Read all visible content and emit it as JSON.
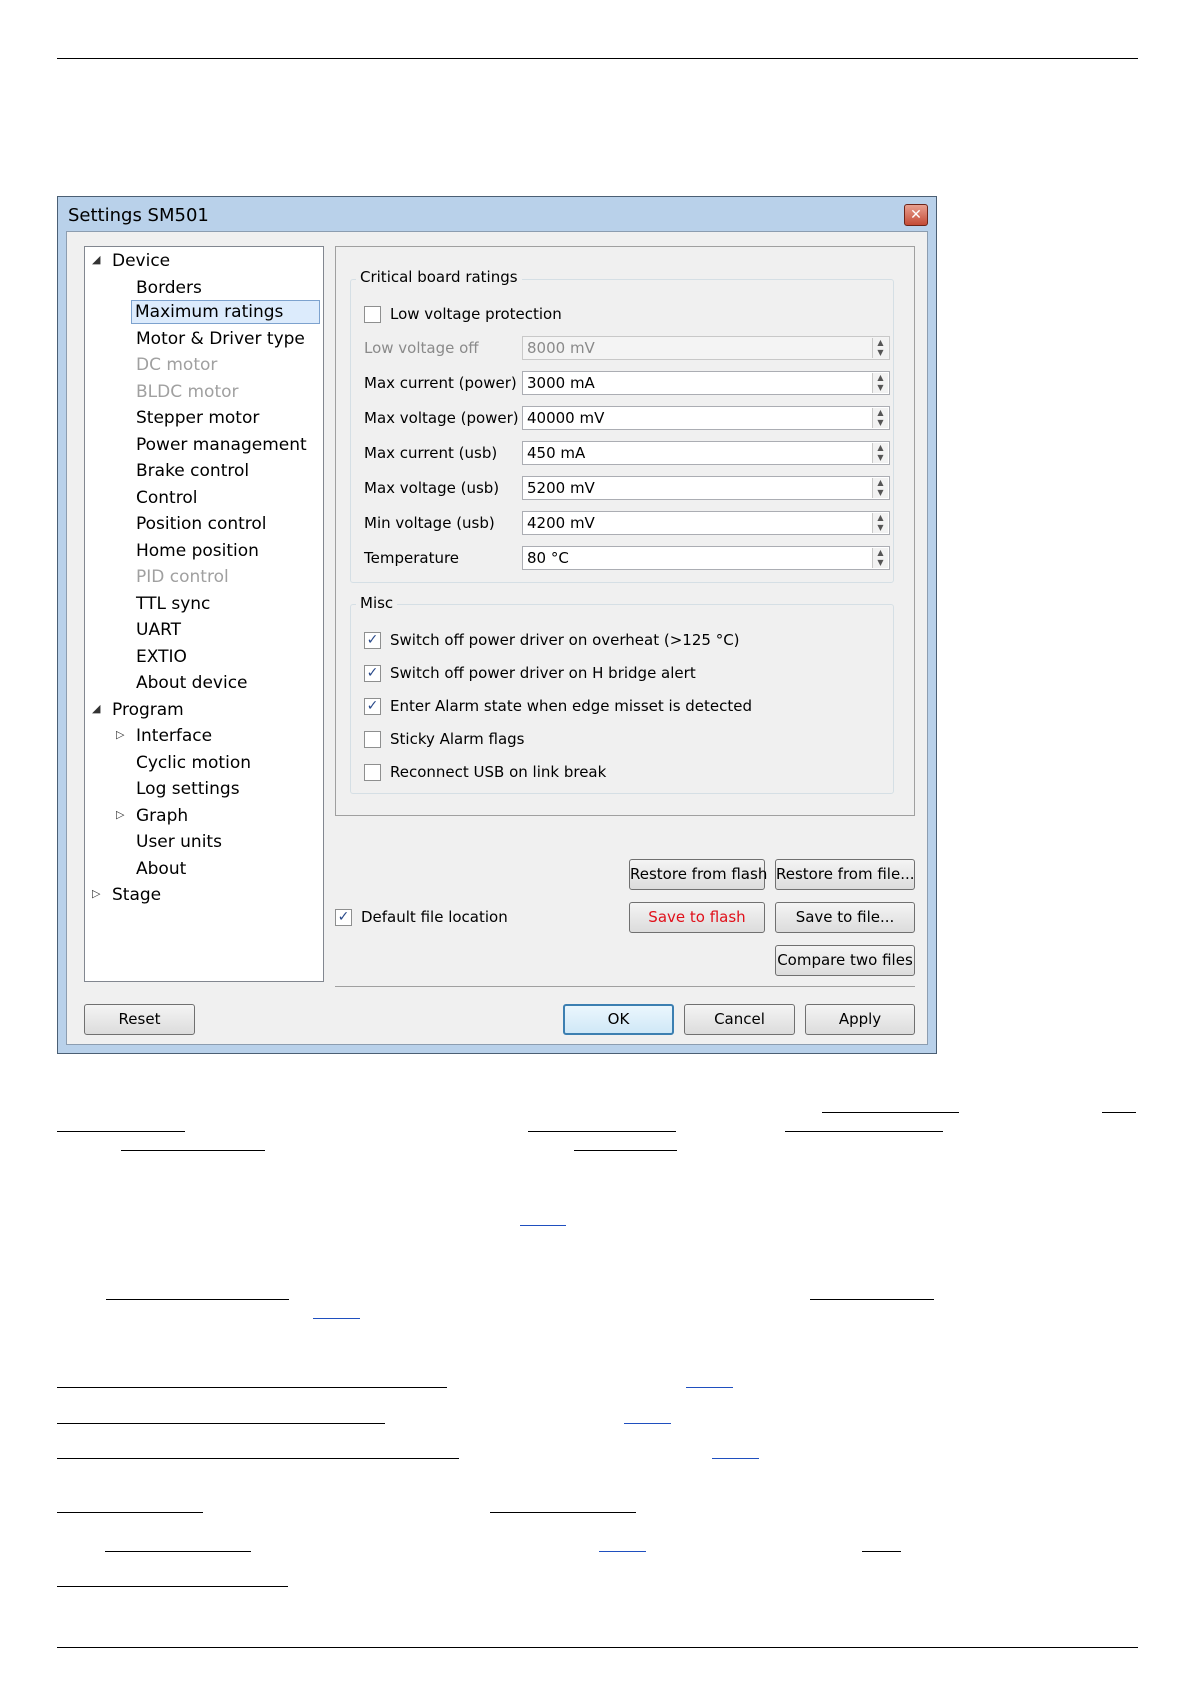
{
  "window": {
    "title": "Settings SM501",
    "close_glyph": "✕"
  },
  "tree": {
    "items": [
      {
        "label": "Device",
        "arrow": "◢"
      },
      {
        "label": "Borders"
      },
      {
        "label": "Maximum ratings"
      },
      {
        "label": "Motor & Driver type"
      },
      {
        "label": "DC motor"
      },
      {
        "label": "BLDC motor"
      },
      {
        "label": "Stepper motor"
      },
      {
        "label": "Power management"
      },
      {
        "label": "Brake control"
      },
      {
        "label": "Control"
      },
      {
        "label": "Position control"
      },
      {
        "label": "Home position"
      },
      {
        "label": "PID control"
      },
      {
        "label": "TTL sync"
      },
      {
        "label": "UART"
      },
      {
        "label": "EXTIO"
      },
      {
        "label": "About device"
      },
      {
        "label": "Program",
        "arrow": "◢"
      },
      {
        "label": "Interface",
        "arrow": "▷"
      },
      {
        "label": "Cyclic motion"
      },
      {
        "label": "Log settings"
      },
      {
        "label": "Graph",
        "arrow": "▷"
      },
      {
        "label": "User units"
      },
      {
        "label": "About"
      },
      {
        "label": "Stage",
        "arrow": "▷"
      }
    ]
  },
  "critical": {
    "title": "Critical board ratings",
    "low_voltage_protection": "Low voltage protection",
    "fields": [
      {
        "label": "Low voltage off",
        "value": "8000 mV"
      },
      {
        "label": "Max current (power)",
        "value": "3000 mA"
      },
      {
        "label": "Max voltage (power)",
        "value": "40000 mV"
      },
      {
        "label": "Max current (usb)",
        "value": "450 mA"
      },
      {
        "label": "Max voltage (usb)",
        "value": "5200 mV"
      },
      {
        "label": "Min voltage (usb)",
        "value": "4200 mV"
      },
      {
        "label": "Temperature",
        "value": "80 °C"
      }
    ],
    "spin_up": "▲",
    "spin_down": "▼"
  },
  "misc": {
    "title": "Misc",
    "checkboxes": [
      {
        "label": "Switch off power driver on overheat (>125 °C)",
        "checked": "✓"
      },
      {
        "label": "Switch off power driver on H bridge alert",
        "checked": "✓"
      },
      {
        "label": "Enter Alarm state when edge misset is detected",
        "checked": "✓"
      },
      {
        "label": "Sticky Alarm flags",
        "checked": ""
      },
      {
        "label": "Reconnect USB on link break",
        "checked": ""
      }
    ]
  },
  "files": {
    "restore_flash": "Restore from flash",
    "restore_file": "Restore from file...",
    "save_flash": "Save to flash",
    "save_file": "Save to file...",
    "compare": "Compare two files",
    "default_location": "Default file location",
    "default_location_checked": "✓"
  },
  "footer": {
    "reset": "Reset",
    "ok": "OK",
    "cancel": "Cancel",
    "apply": "Apply"
  },
  "colors": {
    "save_to_flash_text": "#e0101a",
    "selection": "#dcebfc",
    "window_frame": "#b9d1ea"
  }
}
